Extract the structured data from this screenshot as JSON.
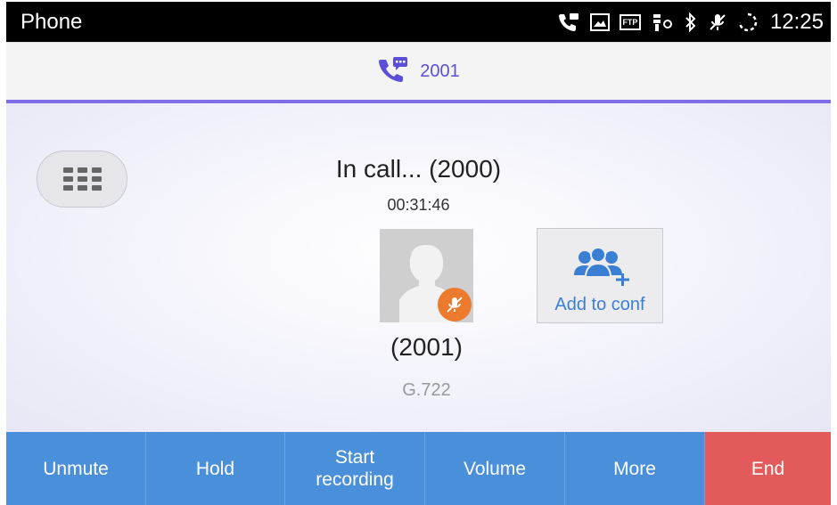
{
  "app_title": "Phone",
  "status_bar": {
    "time": "12:25",
    "icons": [
      "call-icon",
      "image-icon",
      "ftp-icon",
      "usb-icon",
      "bluetooth-icon",
      "mic-muted-icon",
      "sync-icon"
    ],
    "ftp_text": "FTP"
  },
  "call_tab": {
    "label": "2001",
    "icon": "call-message-icon"
  },
  "call": {
    "status": "In call... (2000)",
    "duration": "00:31:46",
    "remote_name": "(2001)",
    "codec": "G.722"
  },
  "add_to_conf_label": "Add to conf",
  "buttons": {
    "unmute": "Unmute",
    "hold": "Hold",
    "start_recording": "Start\nrecording",
    "volume": "Volume",
    "more": "More",
    "end": "End"
  },
  "colors": {
    "action_blue": "#4a8fd9",
    "end_red": "#e25a5a",
    "accent_purple": "#7e6fe8",
    "mute_orange": "#ec7b2e"
  }
}
